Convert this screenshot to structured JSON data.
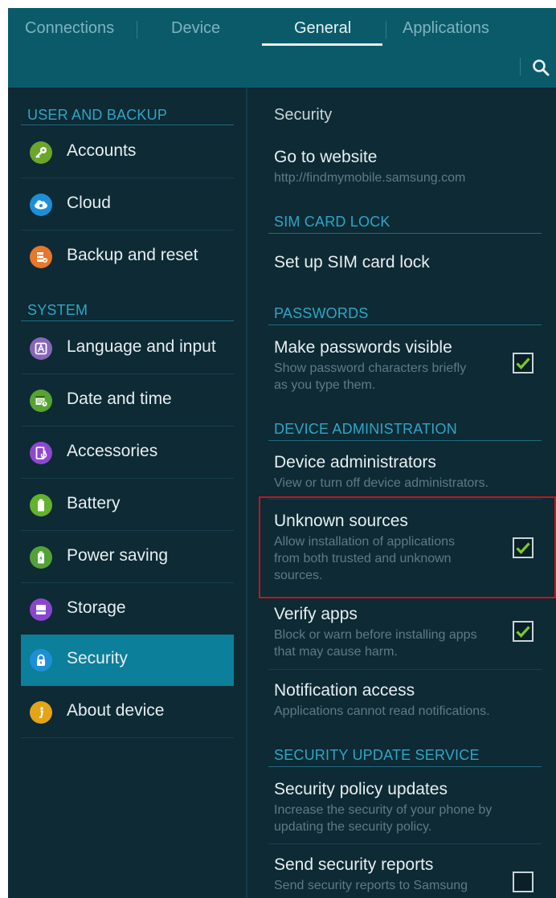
{
  "tabs": [
    {
      "label": "Connections",
      "active": false
    },
    {
      "label": "Device",
      "active": false
    },
    {
      "label": "General",
      "active": true
    },
    {
      "label": "Applications",
      "active": false
    }
  ],
  "toolbar": {
    "search_icon": "search-icon"
  },
  "left": {
    "headers": [
      "USER AND BACKUP",
      "SYSTEM"
    ],
    "items": [
      {
        "label": "Accounts",
        "icon": "key-icon",
        "color": "#6aa629"
      },
      {
        "label": "Cloud",
        "icon": "cloud-icon",
        "color": "#1e8fd6"
      },
      {
        "label": "Backup and reset",
        "icon": "backup-icon",
        "color": "#e8762b"
      },
      {
        "label": "Language and input",
        "icon": "keyboard-letter-icon",
        "color": "#8766b8"
      },
      {
        "label": "Date and time",
        "icon": "calendar-clock-icon",
        "color": "#56a330"
      },
      {
        "label": "Accessories",
        "icon": "accessories-icon",
        "color": "#8e47d1"
      },
      {
        "label": "Battery",
        "icon": "battery-icon",
        "color": "#63b22c"
      },
      {
        "label": "Power saving",
        "icon": "power-saving-icon",
        "color": "#53a237"
      },
      {
        "label": "Storage",
        "icon": "storage-icon",
        "color": "#8a45cf"
      },
      {
        "label": "Security",
        "icon": "lock-icon",
        "color": "#1e8fd6",
        "selected": true
      },
      {
        "label": "About device",
        "icon": "info-icon",
        "color": "#e4a418"
      }
    ]
  },
  "right": {
    "page_title": "Security",
    "go_to_website": {
      "title": "Go to website",
      "subtitle": "http://findmymobile.samsung.com"
    },
    "sim_header": "SIM CARD LOCK",
    "sim_item": "Set up SIM card lock",
    "passwords_header": "PASSWORDS",
    "passwords_visible": {
      "title": "Make passwords visible",
      "subtitle": [
        "Show password characters briefly",
        "as you type them."
      ],
      "checked": true
    },
    "device_admin_header": "DEVICE ADMINISTRATION",
    "device_admins": {
      "title": "Device administrators",
      "subtitle": "View or turn off device administrators."
    },
    "unknown_sources": {
      "title": "Unknown sources",
      "subtitle": [
        "Allow installation of applications",
        "from both trusted and unknown",
        "sources."
      ],
      "checked": true
    },
    "verify_apps": {
      "title": "Verify apps",
      "subtitle": [
        "Block or warn before installing apps",
        "that may cause harm."
      ],
      "checked": true
    },
    "notification_access": {
      "title": "Notification access",
      "subtitle": "Applications cannot read notifications."
    },
    "security_update_header": "SECURITY UPDATE SERVICE",
    "policy_updates": {
      "title": "Security policy updates",
      "subtitle": [
        "Increase the security of your phone by",
        "updating the security policy."
      ]
    },
    "send_reports": {
      "title": "Send security reports",
      "subtitle": "Send security reports to Samsung",
      "checked": false
    }
  },
  "colors": {
    "accent": "#2ea6c4",
    "selected_row": "#0c7f9a",
    "highlight_box": "#c4151c",
    "check": "#7dc82a"
  }
}
